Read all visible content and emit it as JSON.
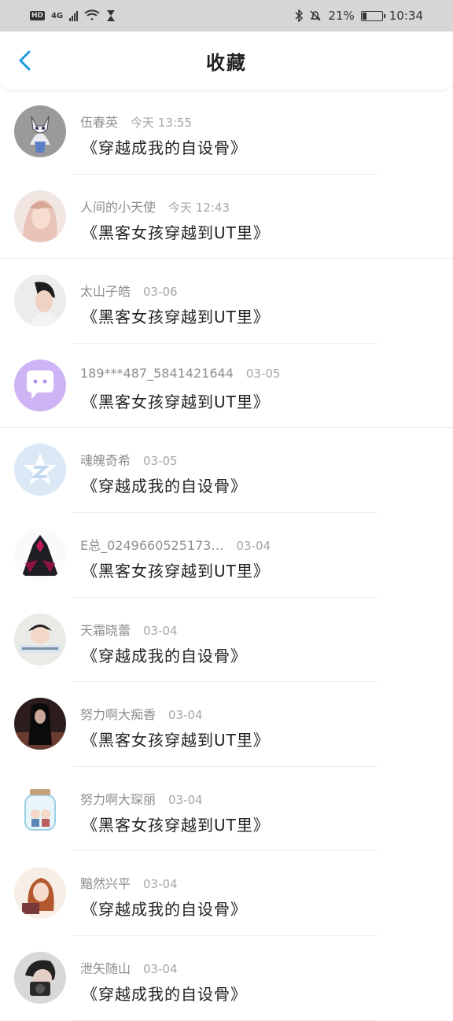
{
  "status_bar": {
    "left_badge": "HD",
    "network": "4G",
    "battery_text": "21%",
    "battery_level": 0.21,
    "time": "10:34"
  },
  "header": {
    "title": "收藏",
    "back_icon": "chevron-left-icon",
    "accent": "#1a9ae0"
  },
  "favorites": [
    {
      "user": "伍春英",
      "time": "今天 13:55",
      "book": "《穿越成我的自设骨》",
      "avatar": "cat-sketch"
    },
    {
      "user": "人间的小天使",
      "time": "今天 12:43",
      "book": "《黑客女孩穿越到UT里》",
      "avatar": "girl-portrait"
    },
    {
      "user": "太山子皓",
      "time": "03-06",
      "book": "《黑客女孩穿越到UT里》",
      "avatar": "boy-portrait"
    },
    {
      "user": "189***487_5841421644",
      "time": "03-05",
      "book": "《黑客女孩穿越到UT里》",
      "avatar": "chat-bubble"
    },
    {
      "user": "魂魄奇希",
      "time": "03-05",
      "book": "《穿越成我的自设骨》",
      "avatar": "default-star"
    },
    {
      "user": "E总_0249660525173…",
      "time": "03-04",
      "book": "《黑客女孩穿越到UT里》",
      "avatar": "dark-warrior"
    },
    {
      "user": "天霜晓蕾",
      "time": "03-04",
      "book": "《穿越成我的自设骨》",
      "avatar": "boy-caption"
    },
    {
      "user": "努力啊大痴香",
      "time": "03-04",
      "book": "《黑客女孩穿越到UT里》",
      "avatar": "dark-hair"
    },
    {
      "user": "努力啊大琛丽",
      "time": "03-04",
      "book": "《黑客女孩穿越到UT里》",
      "avatar": "jar-couple"
    },
    {
      "user": "黯然兴平",
      "time": "03-04",
      "book": "《穿越成我的自设骨》",
      "avatar": "anime-girl"
    },
    {
      "user": "泄矢随山",
      "time": "03-04",
      "book": "《穿越成我的自设骨》",
      "avatar": "camera-boy"
    }
  ]
}
